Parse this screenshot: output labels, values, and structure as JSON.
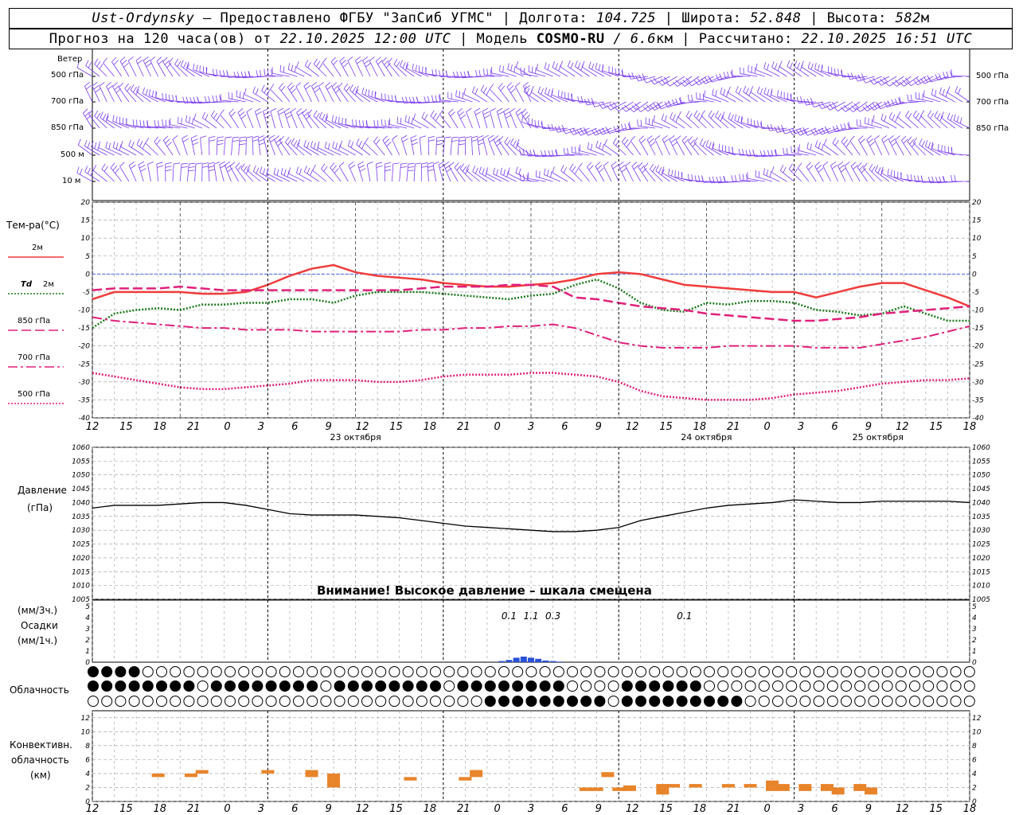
{
  "header": {
    "station": "Ust-Ordynsky",
    "sep1": " – ",
    "provider": "Предоставлено ФГБУ \"ЗапСиб УГМС\" | ",
    "lon_label": "Долгота: ",
    "lon": "104.725",
    "lat_label": " | Широта: ",
    "lat": "52.848",
    "alt_label": " | Высота: ",
    "alt": "582",
    "alt_unit": "м",
    "forecast_label": "Прогноз на 120 часа(ов) от ",
    "forecast_from": "22.10.2025 12:00 UTC",
    "model_label": "  | Модель ",
    "model": "COSMO-RU",
    "model_res": " / 6.6",
    "model_res_unit": "км",
    "calc_label": " | Рассчитано: ",
    "calc_time": "22.10.2025 16:51 UTC"
  },
  "labels": {
    "wind": "Ветер",
    "wind_levels": [
      "500 гПа",
      "700 гПа",
      "850 гПа",
      "500 м",
      "10  м"
    ],
    "temp": "Тем-ра(°C)",
    "t2m": "2м",
    "td": "Td",
    "td2": "2м",
    "t850": "850 гПа",
    "t700": "700 гПа",
    "t500": "500 гПа",
    "pressure": "Давление",
    "pressure_unit": "(гПа)",
    "precip_unit1": "(мм/3ч.)",
    "precip": "Осадки",
    "precip_unit2": "(мм/1ч.)",
    "cloud": "Облачность",
    "conv1": "Конвективн.",
    "conv2": "облачность",
    "conv3": "(км)",
    "warning": "Внимание! Высокое давление – шкала смещена"
  },
  "chart_data": [
    {
      "type": "line",
      "title": "Тем-ра(°C)",
      "x_ticks": [
        "12",
        "15",
        "18",
        "21",
        "0",
        "3",
        "6",
        "9",
        "12",
        "15",
        "18",
        "21",
        "0",
        "3",
        "6",
        "9",
        "12",
        "15",
        "18",
        "21",
        "0",
        "3",
        "6",
        "9",
        "12",
        "15",
        "18"
      ],
      "day_labels": [
        "23 октября",
        "24 октября",
        "25 октября"
      ],
      "ylim": [
        -40,
        20
      ],
      "y_ticks": [
        -40,
        -35,
        -30,
        -25,
        -20,
        -15,
        -10,
        -5,
        0,
        5,
        10,
        15,
        20
      ],
      "x_unit_hours_from_start": true,
      "series": [
        {
          "name": "2м",
          "color": "#f03c3c",
          "style": "solid",
          "x": [
            0,
            3,
            6,
            9,
            12,
            15,
            18,
            21,
            24,
            27,
            30,
            33,
            36,
            39,
            42,
            45,
            48,
            51,
            54,
            57,
            60,
            63,
            66,
            69,
            72,
            75,
            78,
            81,
            84,
            87,
            90,
            93,
            96,
            99,
            102,
            105,
            108,
            111,
            114,
            117,
            120
          ],
          "y": [
            -7,
            -5,
            -5,
            -5,
            -5,
            -5.5,
            -5.5,
            -5,
            -3,
            -0.5,
            1.5,
            2.5,
            0.5,
            -0.5,
            -1,
            -1.5,
            -2.5,
            -3,
            -3.5,
            -3.5,
            -3,
            -2.5,
            -1.5,
            0,
            0.5,
            0,
            -1.5,
            -3,
            -3.5,
            -4,
            -4.5,
            -5,
            -5,
            -6.5,
            -5,
            -3.5,
            -2.5,
            -2.5,
            -4.5,
            -6.5,
            -9
          ]
        },
        {
          "name": "Td 2м",
          "color": "#1e7a1e",
          "style": "dotted",
          "x": [
            0,
            3,
            6,
            9,
            12,
            15,
            18,
            21,
            24,
            27,
            30,
            33,
            36,
            39,
            42,
            45,
            48,
            51,
            54,
            57,
            60,
            63,
            66,
            69,
            72,
            75,
            78,
            81,
            84,
            87,
            90,
            93,
            96,
            99,
            102,
            105,
            108,
            111,
            114,
            117,
            120
          ],
          "y": [
            -15,
            -11,
            -10,
            -9.5,
            -10,
            -8.5,
            -8.5,
            -8,
            -8,
            -7,
            -7,
            -8,
            -6,
            -5,
            -5,
            -5,
            -5.5,
            -6,
            -6.5,
            -7,
            -6,
            -5.5,
            -3,
            -1.5,
            -4,
            -8,
            -10,
            -10.5,
            -8,
            -8.5,
            -7.5,
            -7.5,
            -8,
            -10,
            -10.5,
            -11.5,
            -11,
            -9,
            -11,
            -13,
            -13
          ]
        },
        {
          "name": "850 гПа",
          "color": "#e0207a",
          "style": "dashed",
          "x": [
            0,
            3,
            6,
            9,
            12,
            15,
            18,
            21,
            24,
            27,
            30,
            33,
            36,
            39,
            42,
            45,
            48,
            51,
            54,
            57,
            60,
            63,
            66,
            69,
            72,
            75,
            78,
            81,
            84,
            87,
            90,
            93,
            96,
            99,
            102,
            105,
            108,
            111,
            114,
            117,
            120
          ],
          "y": [
            -4.5,
            -4,
            -4,
            -4,
            -3.5,
            -4,
            -4.5,
            -4.5,
            -4.5,
            -4.5,
            -4.5,
            -4.5,
            -4.5,
            -4.5,
            -4.5,
            -4,
            -3.5,
            -3.5,
            -3.5,
            -3,
            -3,
            -3.5,
            -6.5,
            -7,
            -8,
            -9,
            -9.5,
            -10,
            -11,
            -11.5,
            -12,
            -12.5,
            -13,
            -13,
            -12.5,
            -12,
            -11,
            -10.5,
            -10,
            -9.5,
            -9
          ]
        },
        {
          "name": "700 гПа",
          "color": "#e0207a",
          "style": "dashdot",
          "x": [
            0,
            3,
            6,
            9,
            12,
            15,
            18,
            21,
            24,
            27,
            30,
            33,
            36,
            39,
            42,
            45,
            48,
            51,
            54,
            57,
            60,
            63,
            66,
            69,
            72,
            75,
            78,
            81,
            84,
            87,
            90,
            93,
            96,
            99,
            102,
            105,
            108,
            111,
            114,
            117,
            120
          ],
          "y": [
            -12,
            -13,
            -13.5,
            -14,
            -14.5,
            -15,
            -15,
            -15.5,
            -15.5,
            -15.5,
            -16,
            -16,
            -16,
            -16,
            -16,
            -15.5,
            -15.5,
            -15,
            -15,
            -14.5,
            -14.5,
            -14,
            -15,
            -17,
            -19,
            -20,
            -20.5,
            -20.5,
            -20.5,
            -20,
            -20,
            -20,
            -20,
            -20.5,
            -20.5,
            -20.5,
            -19.5,
            -18.5,
            -17.5,
            -16,
            -14.5
          ]
        },
        {
          "name": "500 гПа",
          "color": "#e0207a",
          "style": "dotted",
          "x": [
            0,
            3,
            6,
            9,
            12,
            15,
            18,
            21,
            24,
            27,
            30,
            33,
            36,
            39,
            42,
            45,
            48,
            51,
            54,
            57,
            60,
            63,
            66,
            69,
            72,
            75,
            78,
            81,
            84,
            87,
            90,
            93,
            96,
            99,
            102,
            105,
            108,
            111,
            114,
            117,
            120
          ],
          "y": [
            -27.5,
            -28.5,
            -29.5,
            -30.5,
            -31.5,
            -32,
            -32,
            -31.5,
            -31,
            -30.5,
            -29.5,
            -29.5,
            -29.5,
            -30,
            -30,
            -29.5,
            -28.5,
            -28,
            -28,
            -28,
            -27.5,
            -27.5,
            -28,
            -28.5,
            -30,
            -32.5,
            -34,
            -34.5,
            -35,
            -35,
            -35,
            -34.5,
            -33.5,
            -33,
            -32.5,
            -31.5,
            -30.5,
            -30,
            -29.5,
            -29.5,
            -29
          ]
        }
      ]
    },
    {
      "type": "line",
      "title": "Давление",
      "ylabel": "(гПа)",
      "ylim": [
        1005,
        1060
      ],
      "y_ticks": [
        1005,
        1010,
        1015,
        1020,
        1025,
        1030,
        1035,
        1040,
        1045,
        1050,
        1055,
        1060
      ],
      "series": [
        {
          "name": "Давление",
          "color": "#000000",
          "x": [
            0,
            3,
            6,
            9,
            12,
            15,
            18,
            21,
            24,
            27,
            30,
            33,
            36,
            39,
            42,
            45,
            48,
            51,
            54,
            57,
            60,
            63,
            66,
            69,
            72,
            75,
            78,
            81,
            84,
            87,
            90,
            93,
            96,
            99,
            102,
            105,
            108,
            111,
            114,
            117,
            120
          ],
          "y": [
            1038,
            1039,
            1039,
            1039,
            1039.5,
            1040,
            1040,
            1039,
            1037.5,
            1036,
            1035.5,
            1035.5,
            1035.5,
            1035,
            1034.5,
            1033.5,
            1032.5,
            1031.5,
            1031,
            1030.5,
            1030,
            1029.5,
            1029.5,
            1030,
            1031,
            1033.5,
            1035,
            1036.5,
            1038,
            1039,
            1039.5,
            1040,
            1041,
            1040.5,
            1040,
            1040,
            1040.5,
            1040.5,
            1040.5,
            1040.5,
            1040
          ]
        }
      ]
    },
    {
      "type": "bar",
      "title": "Осадки",
      "ylim": [
        0,
        5
      ],
      "y_ticks": [
        0,
        1,
        2,
        3,
        4,
        5
      ],
      "annotations": [
        {
          "x": 57,
          "text": "0.1"
        },
        {
          "x": 60,
          "text": "1.1"
        },
        {
          "x": 63,
          "text": "0.3"
        },
        {
          "x": 81,
          "text": "0.1"
        }
      ],
      "bars_x": [
        56,
        57,
        58,
        59,
        60,
        61,
        62,
        63,
        64
      ],
      "bars_y": [
        0.1,
        0.2,
        0.4,
        0.5,
        0.4,
        0.3,
        0.15,
        0.1,
        0.05
      ]
    },
    {
      "type": "bar",
      "title": "Конвективн. облачность",
      "ylabel": "(км)",
      "ylim": [
        0,
        13
      ],
      "y_ticks": [
        0,
        2,
        4,
        6,
        8,
        10,
        12
      ]
    }
  ],
  "colors": {
    "wind": "#7a3cf0",
    "grid": "#9a9a9a",
    "zero_line": "#3050e0",
    "precip_bar": "#2850d8",
    "conv_bar": "#e8842a"
  }
}
